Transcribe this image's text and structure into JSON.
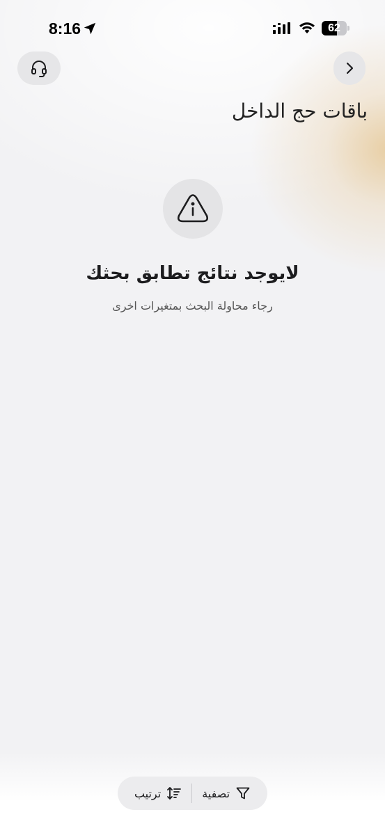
{
  "status_bar": {
    "time": "8:16",
    "battery_percent": "62",
    "battery_level": 0.62,
    "icons": [
      "location-arrow-icon",
      "signal-icon",
      "wifi-icon",
      "battery-icon"
    ]
  },
  "header": {
    "title": "باقات حج الداخل",
    "support_icon": "headset-icon",
    "back_icon": "chevron-right-icon"
  },
  "empty_state": {
    "icon": "info-triangle-icon",
    "title": "لايوجد نتائج تطابق بحثك",
    "subtitle": "رجاء محاولة البحث بمتغيرات اخرى"
  },
  "bottom_bar": {
    "filter_label": "تصفية",
    "filter_icon": "filter-icon",
    "sort_label": "ترتيب",
    "sort_icon": "sort-icon"
  },
  "colors": {
    "background": "#f2f2f4",
    "accent_glow": "#e6c896",
    "button_bg": "#e6e6e8"
  }
}
